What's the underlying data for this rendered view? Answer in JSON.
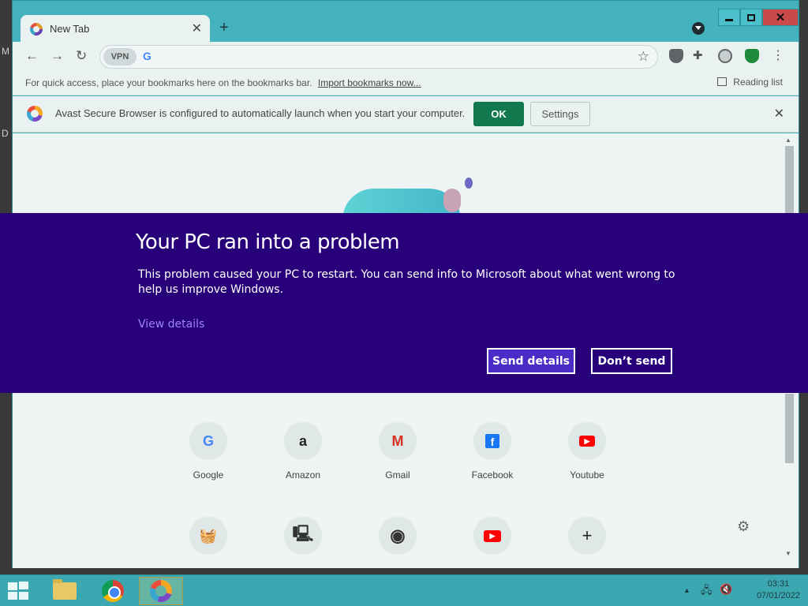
{
  "desktop": {
    "letters": [
      "M",
      "D"
    ]
  },
  "browser": {
    "tab": {
      "title": "New Tab",
      "close": "✕"
    },
    "new_tab": "+",
    "omnibox": {
      "vpn": "VPN",
      "engine": "G"
    },
    "bookmarks_bar": {
      "text": "For quick access, place your bookmarks here on the bookmarks bar.",
      "import_link": "Import bookmarks now...",
      "reading_list": "Reading list"
    },
    "infobar": {
      "message": "Avast Secure Browser is configured to automatically launch when you start your computer.",
      "ok": "OK",
      "settings": "Settings"
    },
    "shortcuts": [
      {
        "label": "Google",
        "glyph": "G",
        "color": "#4285f4"
      },
      {
        "label": "Amazon",
        "glyph": "a",
        "color": "#222222"
      },
      {
        "label": "Gmail",
        "glyph": "M",
        "color": "#d93025"
      },
      {
        "label": "Facebook",
        "glyph": "f",
        "color": "#1877f2"
      },
      {
        "label": "Youtube",
        "glyph": "▶",
        "color": "#ff0000"
      }
    ],
    "shortcuts_row2": [
      {
        "icon": "basket-icon",
        "glyph": "🧺"
      },
      {
        "icon": "computer-icon",
        "glyph": "🖳"
      },
      {
        "icon": "globe-icon",
        "glyph": "◉"
      },
      {
        "icon": "youtube-icon",
        "glyph": "▶"
      },
      {
        "icon": "add-shortcut-icon",
        "glyph": "+"
      }
    ]
  },
  "error_dialog": {
    "title": "Your PC ran into a problem",
    "body": "This problem caused your PC to restart. You can send info to Microsoft about what went wrong to help us improve Windows.",
    "link": "View details",
    "send_button": "Send details",
    "dont_send_button": "Don’t send",
    "background_color": "#27007a"
  },
  "taskbar": {
    "time": "03:31",
    "date": "07/01/2022"
  }
}
